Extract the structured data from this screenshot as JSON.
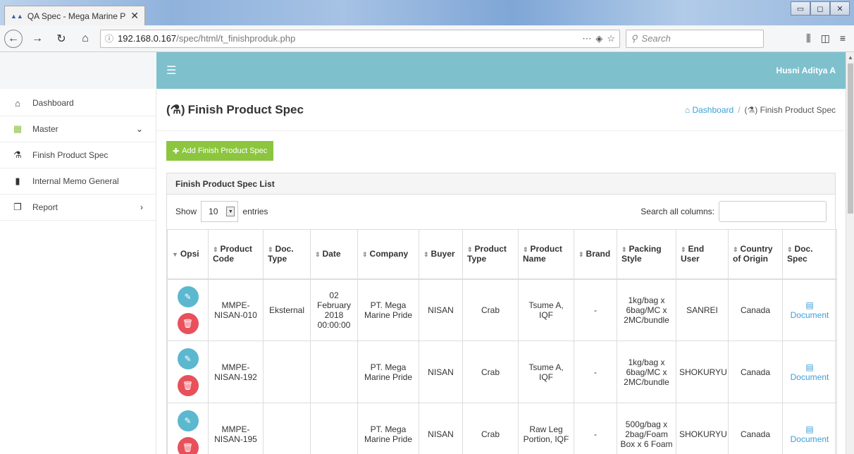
{
  "browser": {
    "tab_title": "QA Spec - Mega Marine Pride",
    "tab_close": "✕",
    "url_host": "192.168.0.167",
    "url_path": "/spec/html/t_finishproduk.php",
    "search_placeholder": "Search",
    "url_actions": "⋯",
    "window_controls": [
      "▭",
      "◻",
      "✕"
    ]
  },
  "header": {
    "user_name": "Husni Aditya A"
  },
  "sidebar": {
    "items": [
      {
        "label": "Dashboard",
        "icon": "home-icon"
      },
      {
        "label": "Master",
        "icon": "grid-icon"
      },
      {
        "label": "Finish Product Spec",
        "icon": "flask-icon"
      },
      {
        "label": "Internal Memo General",
        "icon": "file-icon"
      },
      {
        "label": "Report",
        "icon": "copy-icon"
      }
    ]
  },
  "page": {
    "title": "Finish Product Spec",
    "breadcrumb_home": "Dashboard",
    "breadcrumb_current": "Finish Product Spec",
    "add_button": "Add Finish Product Spec"
  },
  "panel": {
    "title": "Finish Product Spec List",
    "show_label": "Show",
    "entries_value": "10",
    "entries_label": "entries",
    "search_label": "Search all columns:"
  },
  "table": {
    "columns": [
      "Opsi",
      "Product Code",
      "Doc. Type",
      "Date",
      "Company",
      "Buyer",
      "Product Type",
      "Product Name",
      "Brand",
      "Packing Style",
      "End User",
      "Country of Origin",
      "Doc. Spec"
    ],
    "rows": [
      {
        "code": "MMPE-NISAN-010",
        "doc_type": "Eksternal",
        "date": "02 February 2018 00:00:00",
        "company": "PT. Mega Marine Pride",
        "buyer": "NISAN",
        "product_type": "Crab",
        "product_name": "Tsume A, IQF",
        "brand": "-",
        "packing": "1kg/bag x 6bag/MC x 2MC/bundle",
        "end_user": "SANREI",
        "country": "Canada",
        "doc_spec": "Document"
      },
      {
        "code": "MMPE-NISAN-192",
        "doc_type": "",
        "date": "",
        "company": "PT. Mega Marine Pride",
        "buyer": "NISAN",
        "product_type": "Crab",
        "product_name": "Tsume A, IQF",
        "brand": "-",
        "packing": "1kg/bag x 6bag/MC x 2MC/bundle",
        "end_user": "SHOKURYU",
        "country": "Canada",
        "doc_spec": "Document"
      },
      {
        "code": "MMPE-NISAN-195",
        "doc_type": "",
        "date": "",
        "company": "PT. Mega Marine Pride",
        "buyer": "NISAN",
        "product_type": "Crab",
        "product_name": "Raw Leg Portion, IQF",
        "brand": "-",
        "packing": "500g/bag x 2bag/Foam Box x 6 Foam",
        "end_user": "SHOKURYU",
        "country": "Canada",
        "doc_spec": "Document"
      }
    ]
  },
  "colors": {
    "header_bg": "#7fc0cd",
    "add_button": "#8cc63f",
    "edit_button": "#5bb8cf",
    "delete_button": "#e8505b",
    "link": "#3aa0d6"
  }
}
